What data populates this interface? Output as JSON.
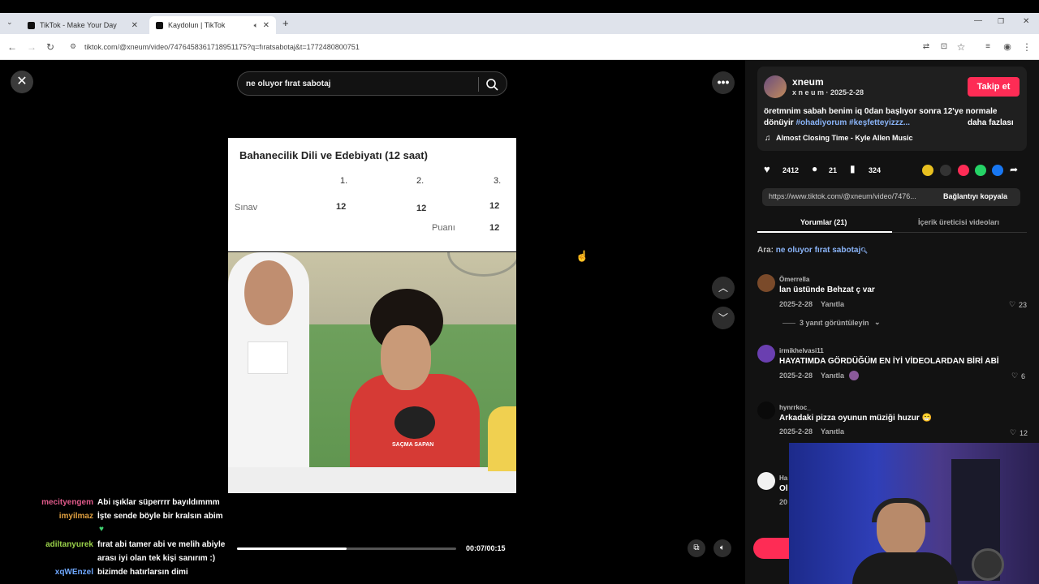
{
  "browser": {
    "tabs": [
      {
        "title": "TikTok - Make Your Day"
      },
      {
        "title": "Kaydolun | TikTok"
      }
    ],
    "url": "tiktok.com/@xneum/video/7476458361718951175?q=fıratsabotaj&t=1772480800751"
  },
  "search": {
    "query": "ne oluyor fırat sabotaj"
  },
  "video": {
    "title": "Bahanecilik Dili ve Edebiyatı (12 saat)",
    "col1": "1.",
    "col2": "2.",
    "col3": "3.",
    "row_label": "Sınav",
    "v1": "12",
    "v2": "12",
    "v3": "12",
    "puan_label": "Puanı",
    "puan_value": "12",
    "shirt_text": "SAÇMA SAPAN",
    "time": "00:07/00:15",
    "progress": 0.5
  },
  "chat": [
    {
      "user": "mecityengem",
      "color": "#e05a8a",
      "text": "Abi ışıklar süperrrr bayıldımmm"
    },
    {
      "user": "imyilmaz",
      "color": "#e0a040",
      "text": "İşte sende böyle bir kralsın abim"
    },
    {
      "user": "",
      "color": "#3fcf6f",
      "text": "♥"
    },
    {
      "user": "adiltanyurek",
      "color": "#9ad24a",
      "text": "fırat abi tamer abi ve melih abiyle"
    },
    {
      "user": "",
      "color": "#ffffff",
      "text": "arası iyi olan tek kişi sanırım :)"
    },
    {
      "user": "xqWEnzel",
      "color": "#6fa8ff",
      "text": "bizimde hatırlarsın dimi"
    }
  ],
  "creator": {
    "name": "xneum",
    "handle": "x n e u m · 2025-2-28",
    "follow": "Takip et",
    "caption_line1": "öretmnim sabah benim iq 0dan başlıyor sonra 12'ye normale",
    "caption_line2_prefix": "dönüyir ",
    "hashtags": "#ohadiyorum #keşfetteyizzz...",
    "more": "daha fazlası",
    "music": "Almost Closing Time - Kyle Allen Music"
  },
  "stats": {
    "likes": "2412",
    "comments": "21",
    "saves": "324"
  },
  "link": {
    "url": "https://www.tiktok.com/@xneum/video/7476...",
    "copy": "Bağlantıyı kopyala"
  },
  "panel_tabs": {
    "comments": "Yorumlar (21)",
    "creator_videos": "İçerik üreticisi videoları"
  },
  "search_hint": {
    "prefix": "Ara: ",
    "query": "ne oluyor fırat sabotaj"
  },
  "comments": [
    {
      "name": "Ömerrella",
      "text": "lan üstünde Behzat ç var",
      "date": "2025-2-28",
      "reply": "Yanıtla",
      "likes": "23",
      "replies": "3 yanıt görüntüleyin"
    },
    {
      "name": "irmikhelvasi11",
      "text": "HAYATIMDA GÖRDÜĞÜM EN İYİ VİDEOLARDAN BİRİ ABİ",
      "date": "2025-2-28",
      "reply": "Yanıtla",
      "likes": "6"
    },
    {
      "name": "hynrrkoc_",
      "text": "Arkadaki pizza oyunun müziği huzur 😁",
      "date": "2025-2-28",
      "reply": "Yanıtla",
      "likes": "12"
    },
    {
      "name": "Ha",
      "text": "Ol",
      "date": "20",
      "reply": "",
      "likes": ""
    }
  ],
  "colors": {
    "accent": "#fe2c55",
    "hashtag": "#8ab4f8",
    "panel": "#121212"
  }
}
